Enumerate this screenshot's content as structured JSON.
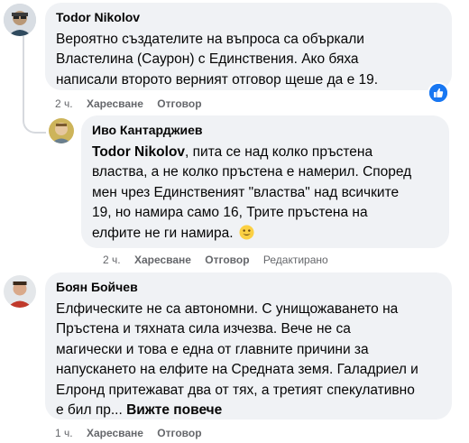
{
  "comments": [
    {
      "author": "Todor Nikolov",
      "lines": [
        "Вероятно създателите на въпроса са объркали",
        "Властелина (Саурон) с Единствения. Ако бяха",
        "написали второто верният отговор щеше да е 19."
      ],
      "time": "2 ч.",
      "like_label": "Харесване",
      "reply_label": "Отговор",
      "reaction_icon": "like-icon",
      "colors": {
        "reaction": "#1877f2"
      }
    },
    {
      "author": "Иво Кантарджиев",
      "mention": "Todor Nikolov",
      "line1_rest": ", пита се над колко пръстена",
      "lines": [
        "властва, а не колко пръстена е намерил. Според",
        "мен чрез Единственият \"властва\" над всичките",
        "19, но намира само 16, Трите пръстена на"
      ],
      "last_line": "елфите не ги намира.",
      "emoji": "smile-emoji",
      "time": "2 ч.",
      "like_label": "Харесване",
      "reply_label": "Отговор",
      "edited_label": "Редактирано"
    },
    {
      "author": "Боян Бойчев",
      "lines": [
        "Елфическите не са автономни. С унищожаването на",
        "Пръстена и тяхната сила изчезва. Вече не са",
        "магически и това е една от главните причини за",
        "напускането на елфите на Средната земя. Галадриел и",
        "Елронд притежават два от тях, а третият спекулативно"
      ],
      "last_line": "е бил пр...",
      "see_more": "Вижте повече",
      "time": "1 ч.",
      "like_label": "Харесване",
      "reply_label": "Отговор"
    }
  ]
}
